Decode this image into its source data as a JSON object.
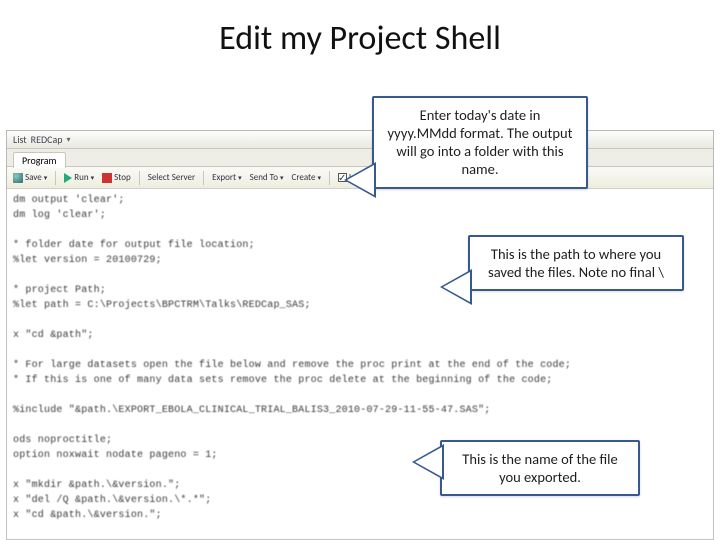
{
  "slide": {
    "title": "Edit my Project Shell"
  },
  "window": {
    "title_prefix": "List",
    "title_name": "REDCap",
    "tab_label": "Program",
    "toolbar": {
      "save": "Save",
      "run": "Run",
      "stop": "Stop",
      "select": "Select Server",
      "export": "Export",
      "sendto": "Send To",
      "create": "Create",
      "log": "Log"
    }
  },
  "code": {
    "l1": "dm output 'clear';",
    "l2": "dm log 'clear';",
    "l3": "",
    "l4": "* folder date for output file location;",
    "l5": "%let version = 20100729;",
    "l6": "",
    "l7": "* project Path;",
    "l8": "%let path = C:\\Projects\\BPCTRM\\Talks\\REDCap_SAS;",
    "l9": "",
    "l10": "x \"cd &path\";",
    "l11": "",
    "l12": "* For large datasets open the file below and remove the proc print at the end of the code;",
    "l13": "* If this is one of many data sets remove the proc delete at the beginning of the code;",
    "l14": "",
    "l15": "%include \"&path.\\EXPORT_EBOLA_CLINICAL_TRIAL_BALIS3_2010-07-29-11-55-47.SAS\";",
    "l16": "",
    "l17": "ods noproctitle;",
    "l18": "option noxwait nodate pageno = 1;",
    "l19": "",
    "l20": "x \"mkdir &path.\\&version.\";",
    "l21": "x \"del /Q &path.\\&version.\\*.*\";",
    "l22": "x \"cd &path.\\&version.\";"
  },
  "callouts": {
    "c1": "Enter today's date in yyyy.MMdd format.  The output will go into a folder with this name.",
    "c2": "This is the path to where you saved the files.  Note no final \\",
    "c3": "This is the name of the file you exported."
  }
}
